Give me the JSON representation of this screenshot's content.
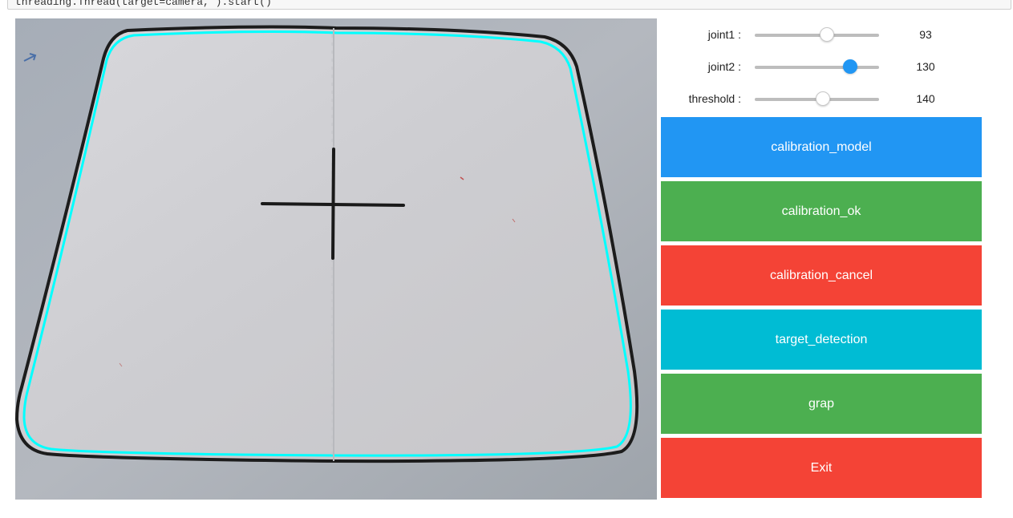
{
  "code_line": "threading.Thread(target=camera, ).start()",
  "sliders": [
    {
      "label": "joint1 :",
      "value": "93",
      "level": 0.58,
      "active": false
    },
    {
      "label": "joint2 :",
      "value": "130",
      "level": 0.77,
      "active": true
    },
    {
      "label": "threshold :",
      "value": "140",
      "level": 0.55,
      "active": false
    }
  ],
  "buttons": [
    {
      "label": "calibration_model",
      "color": "#2196f3"
    },
    {
      "label": "calibration_ok",
      "color": "#4caf50"
    },
    {
      "label": "calibration_cancel",
      "color": "#f44336"
    },
    {
      "label": "target_detection",
      "color": "#00bcd4"
    },
    {
      "label": "grap",
      "color": "#4caf50"
    },
    {
      "label": "Exit",
      "color": "#f44336"
    }
  ],
  "camera": {
    "contour_color": "#00ffff"
  }
}
